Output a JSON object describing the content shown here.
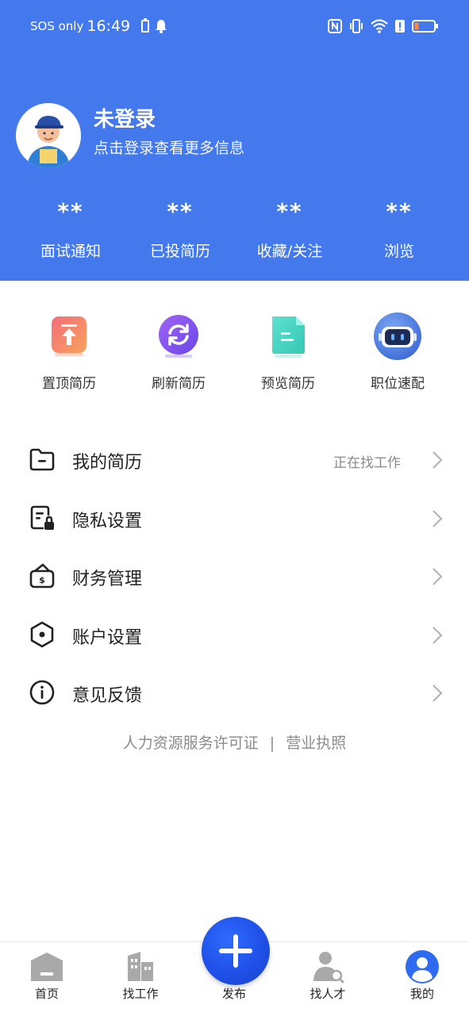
{
  "status_bar": {
    "carrier": "SOS only",
    "time": "16:49"
  },
  "profile": {
    "name": "未登录",
    "subtitle": "点击登录查看更多信息"
  },
  "stats": [
    {
      "value": "**",
      "label": "面试通知"
    },
    {
      "value": "**",
      "label": "已投简历"
    },
    {
      "value": "**",
      "label": "收藏/关注"
    },
    {
      "value": "**",
      "label": "浏览"
    }
  ],
  "quick_actions": [
    {
      "label": "置顶简历",
      "icon": "pin-top-icon"
    },
    {
      "label": "刷新简历",
      "icon": "refresh-icon"
    },
    {
      "label": "预览简历",
      "icon": "document-preview-icon"
    },
    {
      "label": "职位速配",
      "icon": "robot-match-icon"
    }
  ],
  "menu": [
    {
      "label": "我的简历",
      "status": "正在找工作",
      "icon": "folder-icon"
    },
    {
      "label": "隐私设置",
      "status": "",
      "icon": "privacy-lock-icon"
    },
    {
      "label": "财务管理",
      "status": "",
      "icon": "wallet-icon"
    },
    {
      "label": "账户设置",
      "status": "",
      "icon": "hexagon-settings-icon"
    },
    {
      "label": "意见反馈",
      "status": "",
      "icon": "info-icon"
    }
  ],
  "footer": {
    "license": "人力资源服务许可证",
    "separator": "|",
    "business_license": "营业执照"
  },
  "tabbar": {
    "items": [
      {
        "label": "首页",
        "icon": "home-icon"
      },
      {
        "label": "找工作",
        "icon": "building-icon"
      },
      {
        "label": "发布",
        "icon": "plus-icon"
      },
      {
        "label": "找人才",
        "icon": "person-search-icon"
      },
      {
        "label": "我的",
        "icon": "user-icon",
        "active": true
      }
    ]
  },
  "colors": {
    "header_bg": "#4379EC",
    "fab": "#1F50E8"
  }
}
